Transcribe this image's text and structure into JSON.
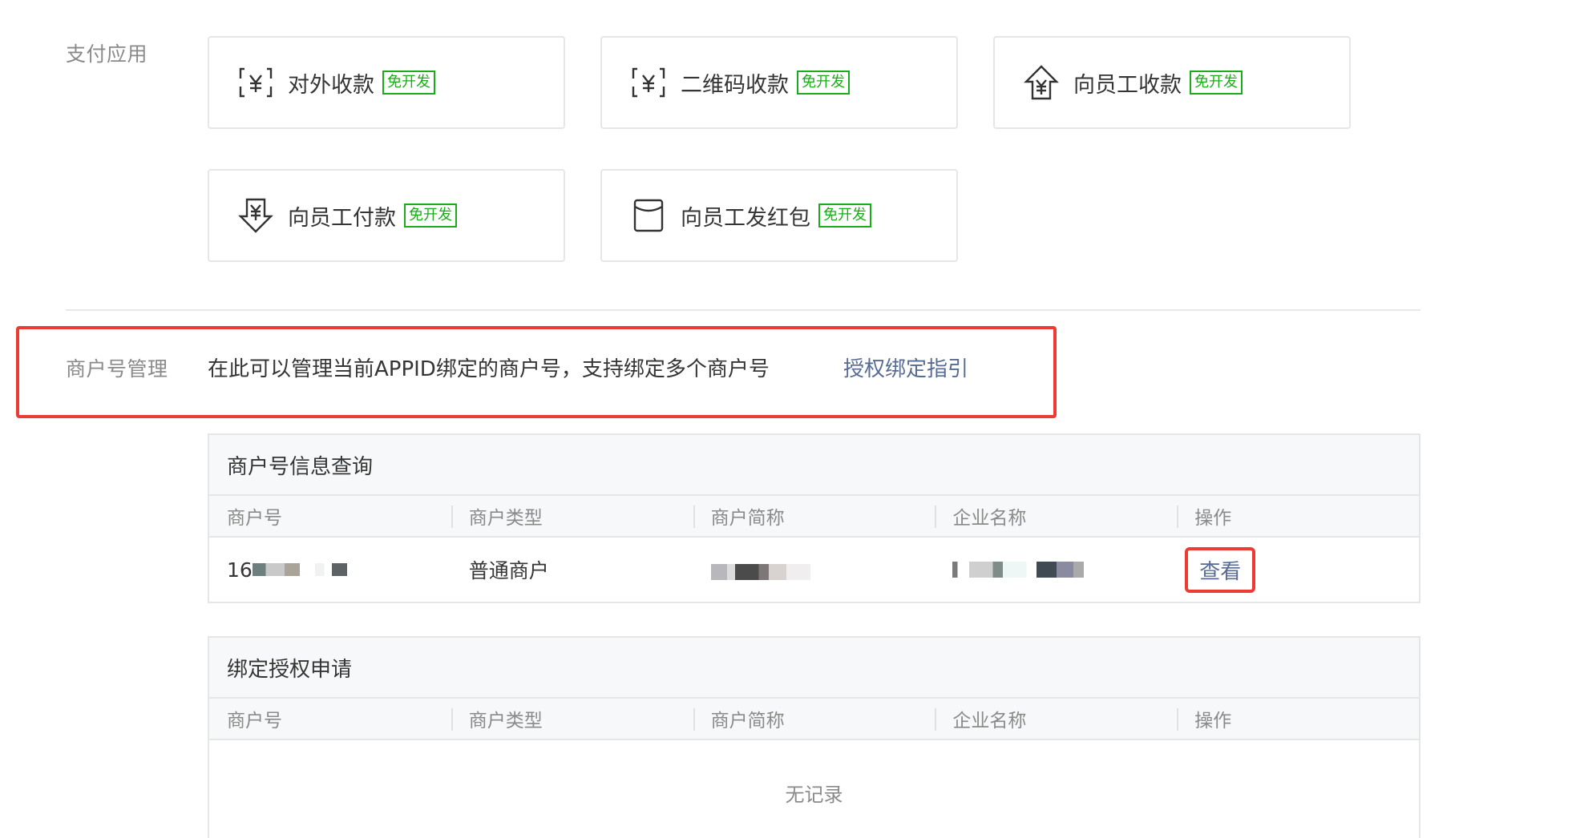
{
  "payment_apps": {
    "label": "支付应用",
    "free_badge": "免开发",
    "items": [
      {
        "name": "对外收款",
        "icon": "yuan-scan-icon"
      },
      {
        "name": "二维码收款",
        "icon": "yuan-scan-icon"
      },
      {
        "name": "向员工收款",
        "icon": "yuan-arrow-up-icon"
      },
      {
        "name": "向员工付款",
        "icon": "yuan-arrow-down-icon"
      },
      {
        "name": "向员工发红包",
        "icon": "red-packet-icon"
      }
    ]
  },
  "merchant_management": {
    "label": "商户号管理",
    "description": "在此可以管理当前APPID绑定的商户号，支持绑定多个商户号",
    "guide_link": "授权绑定指引"
  },
  "merchant_info_query": {
    "title": "商户号信息查询",
    "columns": [
      "商户号",
      "商户类型",
      "商户简称",
      "企业名称",
      "操作"
    ],
    "rows": [
      {
        "merchant_no_prefix": "16",
        "merchant_type": "普通商户",
        "action": "查看"
      }
    ]
  },
  "binding_application": {
    "title": "绑定授权申请",
    "columns": [
      "商户号",
      "商户类型",
      "商户简称",
      "企业名称",
      "操作"
    ],
    "empty_text": "无记录"
  },
  "colors": {
    "badge_green": "#1aad19",
    "link_blue": "#576b95",
    "highlight_red": "#ec3b34"
  }
}
